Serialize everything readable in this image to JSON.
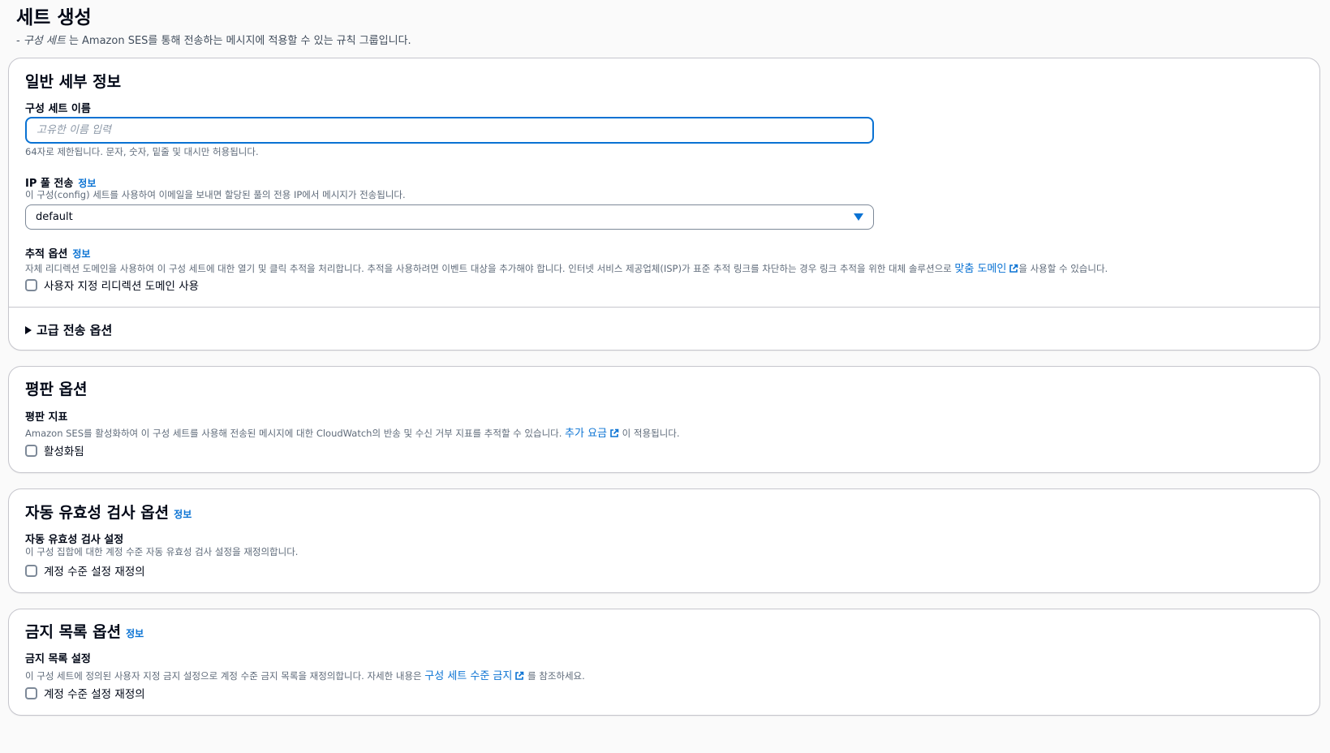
{
  "header": {
    "title": "세트 생성",
    "desc_prefix": "- ",
    "desc_em": "구성 세트",
    "desc_rest": " 는 Amazon SES를 통해 전송하는 메시지에 적용할 수 있는 규칙 그룹입니다."
  },
  "general": {
    "title": "일반 세부 정보",
    "name_label": "구성 세트 이름",
    "name_placeholder": "고유한 이름 입력",
    "name_value": "",
    "name_hint": "64자로 제한됩니다. 문자, 숫자, 밑줄 및 대시만 허용됩니다.",
    "ip_label": "IP 풀 전송",
    "ip_info": "정보",
    "ip_desc": "이 구성(config) 세트를 사용하여 이메일을 보내면 할당된 풀의 전용 IP에서 메시지가 전송됩니다.",
    "ip_selected": "default",
    "tracking_label": "추적 옵션",
    "tracking_info": "정보",
    "tracking_desc": "자체 리디렉션 도메인을 사용하여 이 구성 세트에 대한 열기 및 클릭 추적을 처리합니다. 추적을 사용하려면 이벤트 대상을 추가해야 합니다. 인터넷 서비스 제공업체(ISP)가 표준 추적 링크를 차단하는 경우 링크 추적을 위한 대체 솔루션으로 ",
    "tracking_link": "맞춤 도메인",
    "tracking_desc_end": "을 사용할 수 있습니다.",
    "tracking_checkbox": "사용자 지정 리디렉션 도메인 사용",
    "advanced": "고급 전송 옵션"
  },
  "reputation": {
    "title": "평판 옵션",
    "label": "평판 지표",
    "desc": "Amazon SES를 활성화하여 이 구성 세트를 사용해 전송된 메시지에 대한 CloudWatch의 반송 및 수신 거부 지표를 추적할 수 있습니다. ",
    "link": "추가 요금",
    "desc_end": " 이 적용됩니다.",
    "checkbox": "활성화됨"
  },
  "validation": {
    "title": "자동 유효성 검사 옵션",
    "info": "정보",
    "label": "자동 유효성 검사 설정",
    "desc": "이 구성 집합에 대한 계정 수준 자동 유효성 검사 설정을 재정의합니다.",
    "checkbox": "계정 수준 설정 재정의"
  },
  "suppression": {
    "title": "금지 목록 옵션",
    "info": "정보",
    "label": "금지 목록 설정",
    "desc": "이 구성 세트에 정의된 사용자 지정 금지 설정으로 계정 수준 금지 목록을 재정의합니다. 자세한 내용은 ",
    "link": "구성 세트 수준 금지",
    "desc_end": " 를 참조하세요.",
    "checkbox": "계정 수준 설정 재정의"
  },
  "colors": {
    "link": "#0972d3",
    "border": "#c6c6cd",
    "text": "#000716"
  }
}
